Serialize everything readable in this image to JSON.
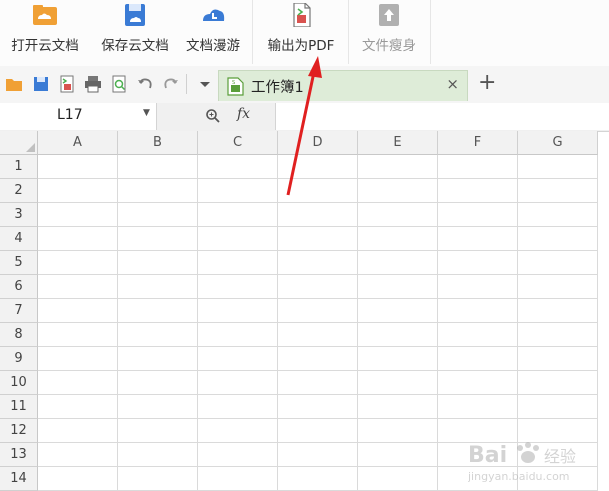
{
  "ribbon": {
    "buttons": [
      {
        "label": "打开云文档",
        "icon": "cloud-folder-open-icon",
        "enabled": true
      },
      {
        "label": "保存云文档",
        "icon": "cloud-save-icon",
        "enabled": true
      },
      {
        "label": "文档漫游",
        "icon": "cloud-roam-icon",
        "enabled": true
      },
      {
        "label": "输出为PDF",
        "icon": "export-pdf-icon",
        "enabled": true
      },
      {
        "label": "文件瘦身",
        "icon": "file-slim-icon",
        "enabled": false
      }
    ]
  },
  "quick_access": {
    "icons": [
      "open-icon",
      "save-icon",
      "export-pdf-small-icon",
      "print-icon",
      "print-preview-icon",
      "undo-icon",
      "redo-icon",
      "dropdown-icon"
    ]
  },
  "tab": {
    "label": "工作簿1",
    "close": "×",
    "new_tab": "+"
  },
  "formula_bar": {
    "cell_ref": "L17",
    "fx": "fx",
    "zoom_icon": "magnifier-icon",
    "value": ""
  },
  "sheet": {
    "columns": [
      "A",
      "B",
      "C",
      "D",
      "E",
      "F",
      "G"
    ],
    "rows": [
      "1",
      "2",
      "3",
      "4",
      "5",
      "6",
      "7",
      "8",
      "9",
      "10",
      "11",
      "12",
      "13",
      "14"
    ]
  },
  "annotation": {
    "color": "#e02020",
    "points_to": "输出为PDF"
  },
  "watermark": {
    "text": "Baidu经验",
    "sub": "jingyan.baidu.com"
  },
  "colors": {
    "accent_green": "#deecd8",
    "header_gray": "#f2f2f2",
    "icon_blue": "#3a7bd5",
    "icon_orange": "#f0a035"
  }
}
